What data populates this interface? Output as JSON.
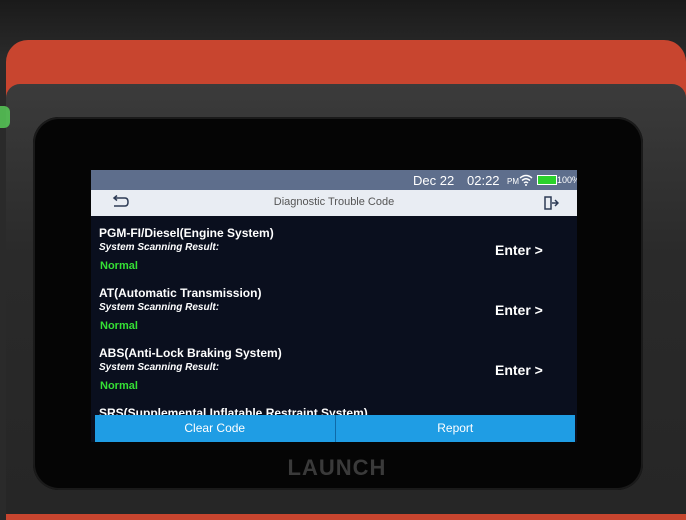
{
  "status_bar": {
    "date": "Dec 22",
    "time": "02:22",
    "ampm": "PM",
    "battery": "100%",
    "battery_color": "#2bd12b"
  },
  "header": {
    "title": "Diagnostic Trouble Code",
    "back_icon": "back-arrow-icon",
    "exit_icon": "exit-icon"
  },
  "systems": [
    {
      "name": "PGM-FI/Diesel(Engine System)",
      "scan_label": "System Scanning Result:",
      "status": "Normal",
      "action": "Enter >"
    },
    {
      "name": "AT(Automatic Transmission)",
      "scan_label": "System Scanning Result:",
      "status": "Normal",
      "action": "Enter >"
    },
    {
      "name": "ABS(Anti-Lock Braking System)",
      "scan_label": "System Scanning Result:",
      "status": "Normal",
      "action": "Enter >"
    },
    {
      "name": "SRS(Supplemental Inflatable Restraint System)"
    }
  ],
  "footer": {
    "clear_label": "Clear Code",
    "report_label": "Report"
  },
  "device": {
    "brand": "LAUNCH"
  },
  "colors": {
    "accent": "#1f9de4",
    "status_ok": "#35e035",
    "shell": "#c8452f"
  }
}
